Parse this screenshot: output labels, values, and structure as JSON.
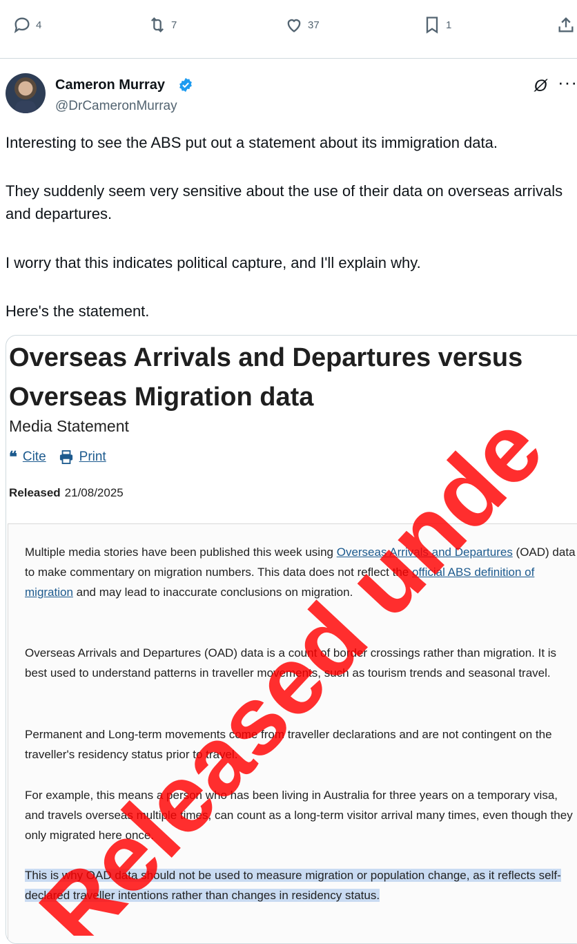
{
  "action_bar": {
    "replies": "4",
    "retweets": "7",
    "likes": "37",
    "bookmarks": "1"
  },
  "tweet": {
    "author_name": "Cameron Murray",
    "author_handle": "@DrCameronMurray",
    "grok_glyph": "Ø",
    "more_glyph": "···",
    "paragraphs": [
      "Interesting to see the ABS put out a statement about its immigration data.",
      "They suddenly seem very sensitive about the use of their data on overseas arrivals and departures.",
      "I worry that this indicates political capture, and I'll explain why.",
      "Here's the statement."
    ]
  },
  "statement": {
    "title": "Overseas Arrivals and Departures versus Overseas Migration data",
    "subtitle": "Media Statement",
    "cite_label": "Cite",
    "print_label": "Print",
    "released_label": "Released",
    "released_date": "21/08/2025",
    "p1_a": "Multiple media stories have been published this week using ",
    "p1_link1": "Overseas Arrivals and Departures",
    "p1_b": " (OAD) data to make commentary on migration numbers. This data does not reflect the ",
    "p1_link2": "official ABS definition of migration",
    "p1_c": " and may lead to inaccurate conclusions on migration.",
    "p2": "Overseas Arrivals and Departures (OAD) data is a count of border crossings rather than migration. It is best used to understand patterns in traveller movements, such as tourism trends and seasonal travel.",
    "p3": "Permanent and Long-term movements come from traveller declarations and are not contingent on the traveller's residency status prior to travel.",
    "p4": "For example, this means a person who has been living in Australia for three years on a temporary visa, and travels overseas multiple times, can count as a long-term visitor arrival many times, even though they only migrated here once.",
    "p5": "This is why OAD data should not be used to measure migration or population change, as it reflects self-declared traveller intentions rather than changes in residency status."
  },
  "watermark": {
    "text": "Released unde",
    "color": "#ff0000"
  }
}
